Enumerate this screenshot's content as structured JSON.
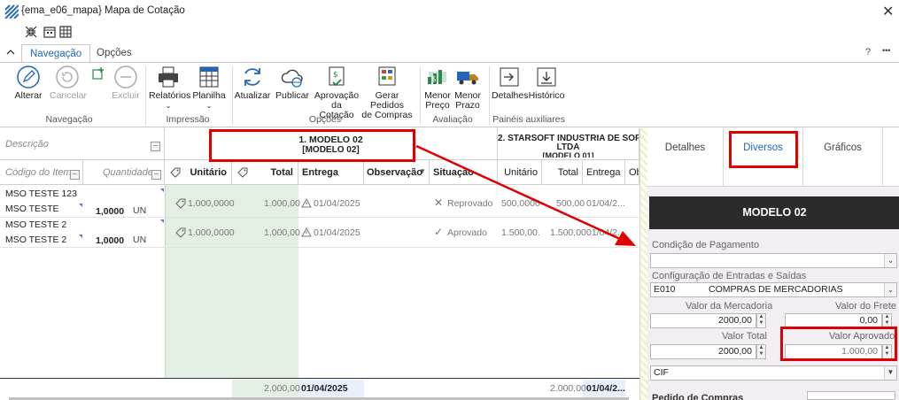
{
  "window": {
    "title": "{ema_e06_mapa}  Mapa de Cotação",
    "close_glyph": "✕"
  },
  "ribbon_tabs": [
    {
      "label": "Navegação"
    },
    {
      "label": "Opções"
    }
  ],
  "ribbon_right": {
    "help": "?",
    "more": "•••"
  },
  "ribbon": {
    "alterar": "Alterar",
    "cancelar": "Cancelar",
    "excluir": "Excluir",
    "relatorios": "Relatórios",
    "planilha": "Planilha",
    "atualizar": "Atualizar",
    "publicar": "Publicar",
    "aprovacao_l1": "Aprovação",
    "aprovacao_l2": "da Cotação",
    "gerar_l1": "Gerar Pedidos",
    "gerar_l2": "de Compras",
    "menor_preco_l1": "Menor",
    "menor_preco_l2": "Preço",
    "menor_prazo_l1": "Menor",
    "menor_prazo_l2": "Prazo",
    "detalhes": "Detalhes",
    "historico": "Histórico",
    "groups": {
      "navegacao": "Navegação",
      "impressao": "Impressão",
      "opcoes": "Opções",
      "avaliacao": "Avaliação",
      "paineis": "Painéis auxiliares"
    }
  },
  "grid": {
    "descricao_header": "Descrição",
    "col_codigo": "Código do Item",
    "col_quantidade": "Quantidade",
    "supplier1": {
      "line1": "1.  MODELO 02",
      "line2": "[MODELO 02]"
    },
    "supplier2": {
      "line1": "2.  STARSOFT INDUSTRIA DE SOFTWA",
      "line2": "LTDA",
      "line3": "[MODELO 01]"
    },
    "cols": {
      "unitario": "Unitário",
      "total": "Total",
      "entrega": "Entrega",
      "observacao": "Observação",
      "situacao": "Situação",
      "ob": "Ob"
    },
    "rows": [
      {
        "codigo": "MSO TESTE 123",
        "descricao": "MSO TESTE",
        "quantidade": "1,0000",
        "un": "UN",
        "s1_unitario": "1.000,0000",
        "s1_total": "1.000,00",
        "s1_entrega": "01/04/2025",
        "s1_situacao": "Reprovado",
        "s2_unitario": "500,0000",
        "s2_total": "500,00",
        "s2_entrega": "01/04/2..."
      },
      {
        "codigo": "MSO TESTE 2",
        "descricao": "MSO TESTE 2",
        "quantidade": "1,0000",
        "un": "UN",
        "s1_unitario": "1.000,0000",
        "s1_total": "1.000,00",
        "s1_entrega": "01/04/2025",
        "s1_situacao": "Aprovado",
        "s2_unitario": "1.500,00...",
        "s2_total": "1.500,00",
        "s2_entrega": "01/04/2..."
      }
    ],
    "footer": {
      "s1_total": "2.000,00",
      "s1_entrega": "01/04/2025",
      "s2_total": "2.000,00",
      "s2_entrega": "01/04/2..."
    }
  },
  "panel": {
    "tabs": [
      {
        "label": "Detalhes"
      },
      {
        "label": "Diversos"
      },
      {
        "label": "Gráficos"
      }
    ],
    "header": "MODELO 02",
    "condicao_label": "Condição de Pagamento",
    "condicao_value": "",
    "config_label": "Configuração de Entradas e Saídas",
    "config_code": "E010",
    "config_desc": "COMPRAS DE MERCADORIAS",
    "valor_mercadoria_label": "Valor da Mercadoria",
    "valor_mercadoria": "2000,00",
    "valor_frete_label": "Valor do Frete",
    "valor_frete": "0,00",
    "valor_total_label": "Valor Total",
    "valor_total": "2000,00",
    "valor_aprovado_label": "Valor Aprovado",
    "valor_aprovado": "1.000,00",
    "frete_tipo": "CIF",
    "pedido_label": "Pedido de Compras"
  },
  "colors": {
    "accent": "#2266bb",
    "highlight": "#e00000",
    "green_cell": "#e4efe4",
    "panel_header": "#2b2b2b"
  }
}
